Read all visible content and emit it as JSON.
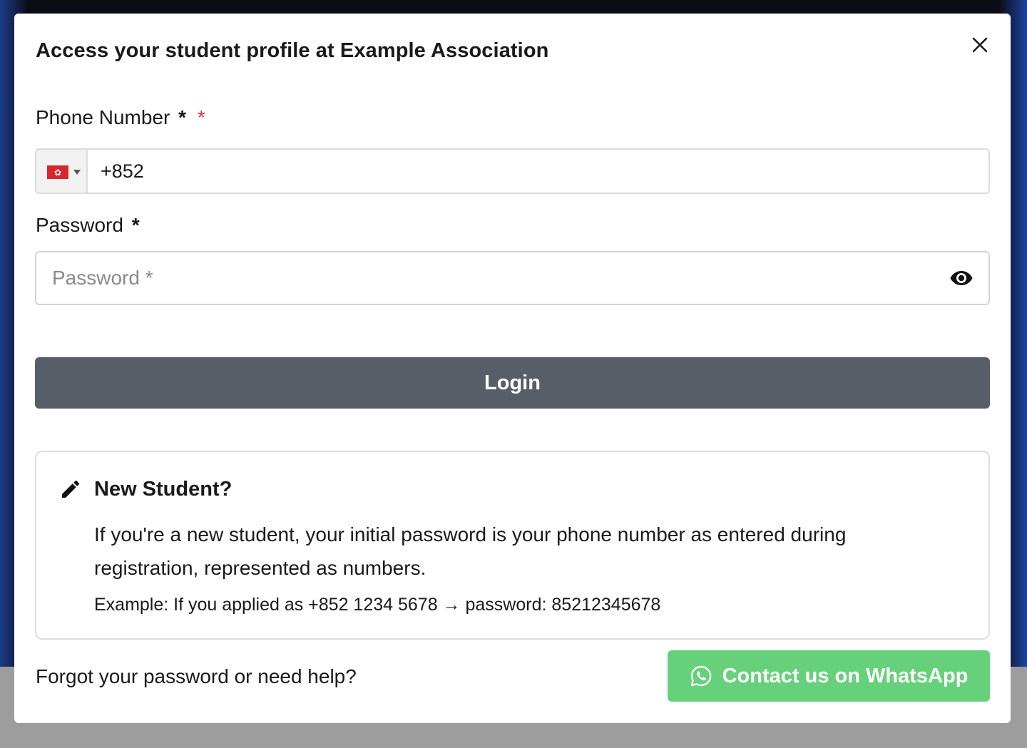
{
  "modal": {
    "title": "Access your student profile at Example Association"
  },
  "phone": {
    "label": "Phone Number",
    "required_mark": "*",
    "required_mark_red": "*",
    "country_flag": "hong-kong-flag",
    "value": "+852"
  },
  "password": {
    "label": "Password",
    "required_mark": "*",
    "placeholder": "Password *"
  },
  "login": {
    "label": "Login"
  },
  "new_student": {
    "title": "New Student?",
    "body": "If you're a new student, your initial password is your phone number as entered during registration, represented as numbers.",
    "example": "Example: If you applied as +852 1234 5678 → password: 85212345678"
  },
  "footer": {
    "help_text": "Forgot your password or need help?",
    "whatsapp_label": "Contact us on WhatsApp"
  },
  "colors": {
    "login_button": "#585e68",
    "whatsapp_button": "#66d17a",
    "required_red": "#e0333a"
  },
  "icons": {
    "close": "close-icon",
    "eye": "eye-icon",
    "pencil": "pencil-icon",
    "whatsapp": "whatsapp-icon",
    "caret": "caret-down-icon"
  }
}
